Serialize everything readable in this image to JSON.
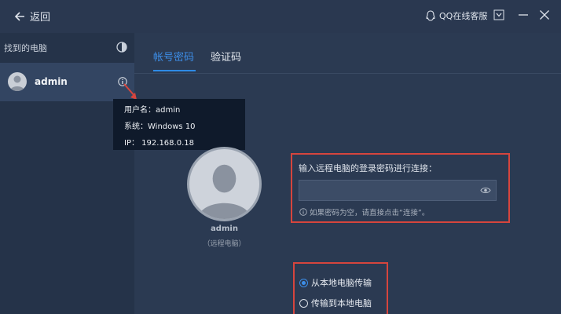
{
  "titlebar": {
    "back_label": "返回",
    "qq_service_label": "QQ在线客服"
  },
  "sidebar": {
    "header": "找到的电脑",
    "devices": [
      {
        "name": "admin"
      }
    ]
  },
  "tooltip": {
    "username_label": "用户名：",
    "username_value": "admin",
    "system_label": "系统：",
    "system_value": "Windows 10",
    "ip_label": "IP：",
    "ip_value": "192.168.0.18"
  },
  "tabs": [
    {
      "label": "帐号密码",
      "active": true
    },
    {
      "label": "验证码",
      "active": false
    }
  ],
  "remote": {
    "name": "admin",
    "subtitle": "（远程电脑）"
  },
  "password": {
    "label": "输入远程电脑的登录密码进行连接：",
    "value": "",
    "placeholder": "",
    "hint": "如果密码为空，请直接点击“连接”。"
  },
  "transfer": {
    "options": [
      {
        "label": "从本地电脑传输",
        "selected": true
      },
      {
        "label": "传输到本地电脑",
        "selected": false
      }
    ]
  },
  "colors": {
    "accent": "#3d8ee8",
    "annotation_red": "#d6453d",
    "background": "#2b3a52"
  }
}
